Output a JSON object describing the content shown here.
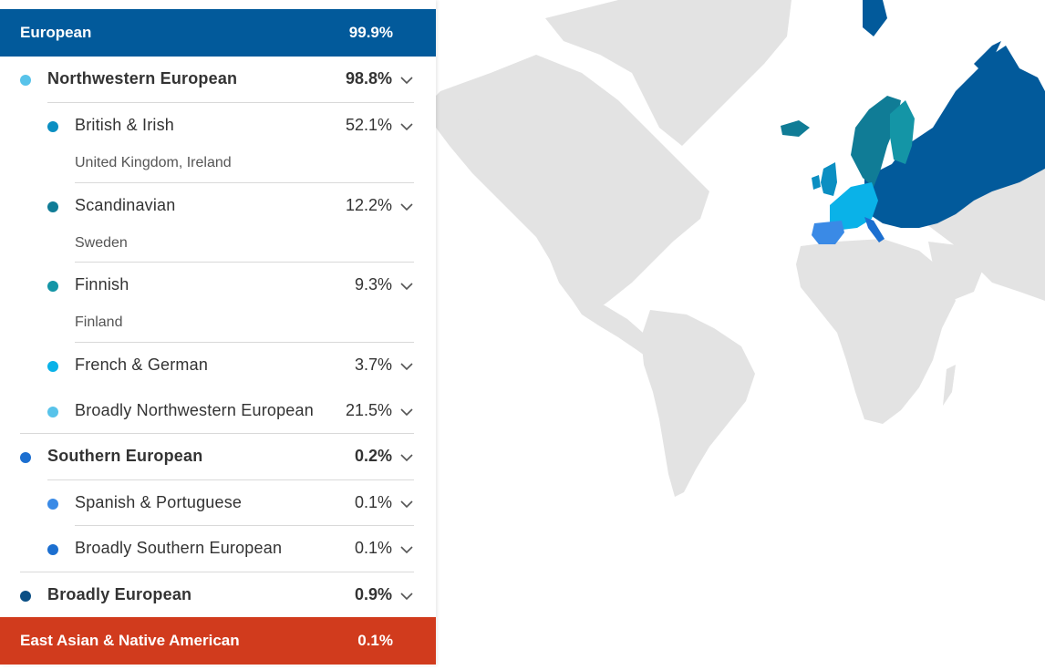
{
  "panel": {
    "european": {
      "label": "European",
      "pct": "99.9%"
    },
    "rows": [
      {
        "label": "Northwestern European",
        "pct": "98.8%",
        "color": "#58c3ea",
        "level": 1
      },
      {
        "label": "British & Irish",
        "pct": "52.1%",
        "sub": "United Kingdom, Ireland",
        "color": "#0b8fc2",
        "level": 2
      },
      {
        "label": "Scandinavian",
        "pct": "12.2%",
        "sub": "Sweden",
        "color": "#107c96",
        "level": 2
      },
      {
        "label": "Finnish",
        "pct": "9.3%",
        "sub": "Finland",
        "color": "#1495a6",
        "level": 2
      },
      {
        "label": "French & German",
        "pct": "3.7%",
        "color": "#0ab2e8",
        "level": 2
      },
      {
        "label": "Broadly Northwestern European",
        "pct": "21.5%",
        "color": "#58c3ea",
        "level": 2
      },
      {
        "label": "Southern European",
        "pct": "0.2%",
        "color": "#1c6fd0",
        "level": 1
      },
      {
        "label": "Spanish & Portuguese",
        "pct": "0.1%",
        "color": "#3a8ae6",
        "level": 2
      },
      {
        "label": "Broadly Southern European",
        "pct": "0.1%",
        "color": "#1c6fd0",
        "level": 2
      },
      {
        "label": "Broadly European",
        "pct": "0.9%",
        "color": "#0b4f85",
        "level": 1
      }
    ],
    "east_asian": {
      "label": "East Asian & Native American",
      "pct": "0.1%"
    }
  },
  "map": {
    "land_color": "#e3e3e3",
    "region_colors": {
      "broadly_european": "#025a9b",
      "british_irish": "#0b8fc2",
      "scandinavian": "#107c96",
      "finnish": "#1495a6",
      "french_german": "#0ab2e8",
      "spanish_portuguese": "#3a8ae6",
      "southern": "#1c6fd0"
    }
  }
}
